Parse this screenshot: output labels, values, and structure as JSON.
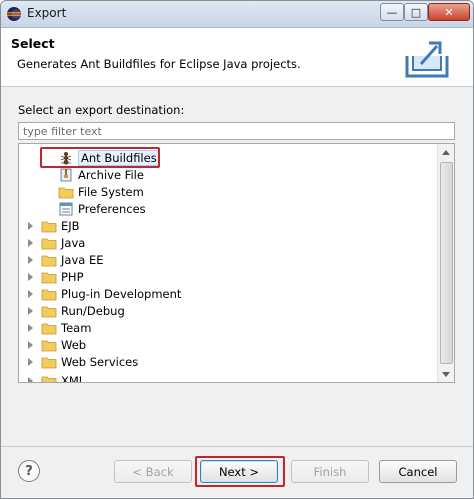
{
  "window": {
    "title": "Export",
    "minimize_label": "—",
    "maximize_label": "□",
    "close_label": "✕"
  },
  "header": {
    "title": "Select",
    "description": "Generates Ant Buildfiles for Eclipse Java projects."
  },
  "destination": {
    "label": "Select an export destination:",
    "filter_placeholder": "type filter text"
  },
  "tree": {
    "general_children": [
      {
        "label": "Ant Buildfiles",
        "icon": "ant-icon",
        "selected": true
      },
      {
        "label": "Archive File",
        "icon": "archive-icon"
      },
      {
        "label": "File System",
        "icon": "folder-icon"
      },
      {
        "label": "Preferences",
        "icon": "preferences-icon"
      }
    ],
    "categories": [
      {
        "label": "EJB"
      },
      {
        "label": "Java"
      },
      {
        "label": "Java EE"
      },
      {
        "label": "PHP"
      },
      {
        "label": "Plug-in Development"
      },
      {
        "label": "Run/Debug"
      },
      {
        "label": "Team"
      },
      {
        "label": "Web"
      },
      {
        "label": "Web Services"
      },
      {
        "label": "XML"
      }
    ]
  },
  "buttons": {
    "help": "?",
    "back": "< Back",
    "next": "Next >",
    "finish": "Finish",
    "cancel": "Cancel"
  },
  "colors": {
    "highlight_outline": "#c0262c",
    "folder": "#e8b84a"
  }
}
